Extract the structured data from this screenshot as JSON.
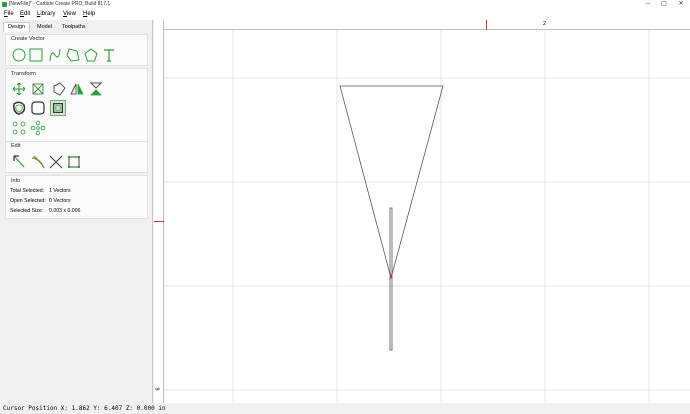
{
  "window": {
    "title": "[NewFile]* - Carbide Create PRO, Build 817.1",
    "icon": "app-icon"
  },
  "window_controls": {
    "minimize": "–",
    "maximize": "▢",
    "close": "✕"
  },
  "menu": [
    "File",
    "Edit",
    "Library",
    "View",
    "Help"
  ],
  "tabs": {
    "design": "Design",
    "model": "Model",
    "toolpaths": "Toolpaths"
  },
  "sections": {
    "create_vector": "Create Vector",
    "transform": "Transform",
    "edit": "Edit",
    "info": "Info"
  },
  "tools": {
    "create": [
      "circle-icon",
      "rectangle-icon",
      "curve-icon",
      "polygon-icon",
      "pentagon-icon",
      "text-icon"
    ],
    "transform_row1": [
      "move-icon",
      "scale-icon",
      "rotate-icon",
      "mirror-icon",
      "flip-icon"
    ],
    "transform_row2": [
      "offset-icon",
      "fillet-icon",
      "boolean-icon"
    ],
    "transform_row3": [
      "array-icon",
      "circular-array-icon"
    ],
    "edit": [
      "node-edit-icon",
      "trim-icon",
      "cut-icon",
      "bounding-box-icon"
    ]
  },
  "info": {
    "total_selected_label": "Total Selected:",
    "total_selected_value": "1 Vectors",
    "open_selected_label": "Open Selected:",
    "open_selected_value": "0 Vectors",
    "selected_size_label": "Selected Size:",
    "selected_size_value": "0.003 x 0.006"
  },
  "ruler": {
    "top_label": "2",
    "left_label": "6"
  },
  "colors": {
    "accent_green": "#2e9b3a",
    "ruler_marker": "#c0392b",
    "grid": "#dedede"
  },
  "status": {
    "cursor_position": "Cursor Position X: 1.862 Y: 6.407 Z: 0.000 in"
  }
}
